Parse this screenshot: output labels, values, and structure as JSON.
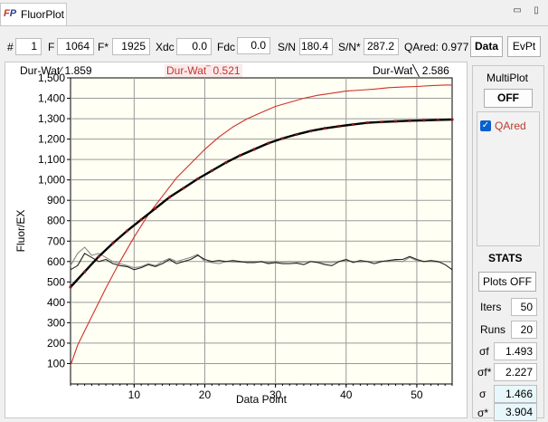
{
  "tab": {
    "logo_f": "F",
    "logo_p": "P",
    "title": "FluorPlot"
  },
  "window_buttons": {
    "minimize": "▭",
    "close": "▯"
  },
  "toolbar": {
    "hash_label": "#",
    "hash_value": "1",
    "f_label": "F",
    "f_value": "1064",
    "fstar_label": "F*",
    "fstar_value": "1925",
    "xdc_label": "Xdc",
    "xdc_value": "0.0",
    "fdc_label": "Fdc",
    "fdc_value": "0.0",
    "sn_label": "S/N",
    "sn_value": "180.4",
    "snstar_label": "S/N*",
    "snstar_value": "287.2",
    "qared_text": "QAred: 0.977",
    "data_button": "Data",
    "evpt_button": "EvPt"
  },
  "chart_top": {
    "left": "Dur-Wat∕ 1.859",
    "mid": "Dur-Wat‾ 0.521",
    "right": "Dur-Wat╲ 2.586"
  },
  "right_panel": {
    "multiplot_label": "MultiPlot",
    "multiplot_button": "OFF",
    "qared_item": "QAred",
    "stats_label": "STATS",
    "plots_button": "Plots OFF",
    "iters_label": "Iters",
    "iters_value": "50",
    "runs_label": "Runs",
    "runs_value": "20",
    "sf_label": "σf",
    "sf_value": "1.493",
    "sfstar_label": "σf*",
    "sfstar_value": "2.227",
    "s_label": "σ",
    "s_value": "1.466",
    "sstar_label": "σ*",
    "sstar_value": "3.904"
  },
  "colors": {
    "plot_bg": "#fffff3",
    "grid": "#9a9a9a",
    "fit": "#000000",
    "red": "#d0302a",
    "points": "#8b1a1a"
  },
  "chart_data": {
    "type": "line",
    "xlabel": "Data Point",
    "ylabel": "Fluor/EX",
    "xlim": [
      1,
      55
    ],
    "ylim": [
      0,
      1500
    ],
    "xticks": [
      10,
      20,
      30,
      40,
      50
    ],
    "yticks": [
      100,
      200,
      300,
      400,
      500,
      600,
      700,
      800,
      900,
      1000,
      1100,
      1200,
      1300,
      1400,
      1500
    ],
    "ytick_labels": [
      "100",
      "200",
      "300",
      "400",
      "500",
      "600",
      "700",
      "800",
      "900",
      "1,000",
      "1,100",
      "1,200",
      "1,300",
      "1,400",
      "1,500"
    ],
    "grid": true,
    "series": [
      {
        "name": "fit",
        "x": [
          1,
          3,
          5,
          7,
          9,
          11,
          13,
          15,
          17,
          19,
          21,
          23,
          25,
          27,
          29,
          31,
          33,
          35,
          37,
          39,
          41,
          43,
          45,
          47,
          49,
          51,
          53,
          55
        ],
        "values": [
          475,
          550,
          625,
          690,
          750,
          805,
          860,
          915,
          960,
          1005,
          1045,
          1085,
          1120,
          1150,
          1180,
          1203,
          1223,
          1240,
          1253,
          1263,
          1272,
          1280,
          1284,
          1287,
          1290,
          1292,
          1294,
          1296
        ]
      },
      {
        "name": "red",
        "x": [
          1,
          2,
          4,
          6,
          8,
          10,
          12,
          14,
          16,
          18,
          20,
          22,
          24,
          26,
          28,
          30,
          32,
          34,
          36,
          38,
          40,
          42,
          44,
          46,
          48,
          50,
          52,
          54,
          55
        ],
        "values": [
          90,
          190,
          330,
          470,
          600,
          720,
          830,
          920,
          1010,
          1080,
          1150,
          1210,
          1260,
          1300,
          1330,
          1360,
          1380,
          1400,
          1415,
          1425,
          1435,
          1440,
          1445,
          1452,
          1455,
          1458,
          1462,
          1465,
          1465
        ]
      },
      {
        "name": "residual-dark",
        "x": [
          1,
          2,
          3,
          4,
          5,
          6,
          7,
          8,
          9,
          10,
          11,
          12,
          13,
          14,
          15,
          16,
          17,
          18,
          19,
          20,
          21,
          22,
          23,
          24,
          25,
          26,
          27,
          28,
          29,
          30,
          31,
          32,
          33,
          34,
          35,
          36,
          37,
          38,
          39,
          40,
          41,
          42,
          43,
          44,
          45,
          46,
          47,
          48,
          49,
          50,
          51,
          52,
          53,
          54,
          55
        ],
        "values": [
          560,
          580,
          640,
          620,
          600,
          610,
          590,
          580,
          575,
          560,
          570,
          585,
          575,
          590,
          610,
          590,
          600,
          610,
          630,
          610,
          600,
          605,
          600,
          605,
          600,
          595,
          595,
          600,
          590,
          595,
          590,
          590,
          592,
          585,
          600,
          595,
          585,
          580,
          600,
          610,
          595,
          605,
          600,
          590,
          600,
          605,
          610,
          610,
          625,
          610,
          600,
          605,
          600,
          585,
          560
        ]
      },
      {
        "name": "residual-gray",
        "x": [
          1,
          2,
          3,
          4,
          5,
          6,
          7,
          8,
          9,
          10,
          11,
          12,
          13,
          14,
          15,
          16,
          17,
          18,
          19,
          20,
          21,
          22,
          23,
          24,
          25,
          26,
          27,
          28,
          29,
          30,
          31,
          32,
          33,
          34,
          35,
          36,
          37,
          38,
          39,
          40,
          41,
          42,
          43,
          44,
          45,
          46,
          47,
          48,
          49,
          50,
          51,
          52,
          53,
          54,
          55
        ],
        "values": [
          580,
          640,
          670,
          630,
          640,
          620,
          600,
          590,
          580,
          570,
          575,
          590,
          580,
          600,
          615,
          600,
          610,
          620,
          635,
          600,
          595,
          590,
          600,
          598,
          597,
          600,
          600,
          598,
          595,
          600,
          598,
          600,
          598,
          597,
          600,
          598,
          595,
          595,
          600,
          605,
          600,
          598,
          600,
          600,
          602,
          600,
          605,
          600,
          620,
          605,
          600,
          600,
          598,
          600,
          598
        ]
      }
    ]
  }
}
